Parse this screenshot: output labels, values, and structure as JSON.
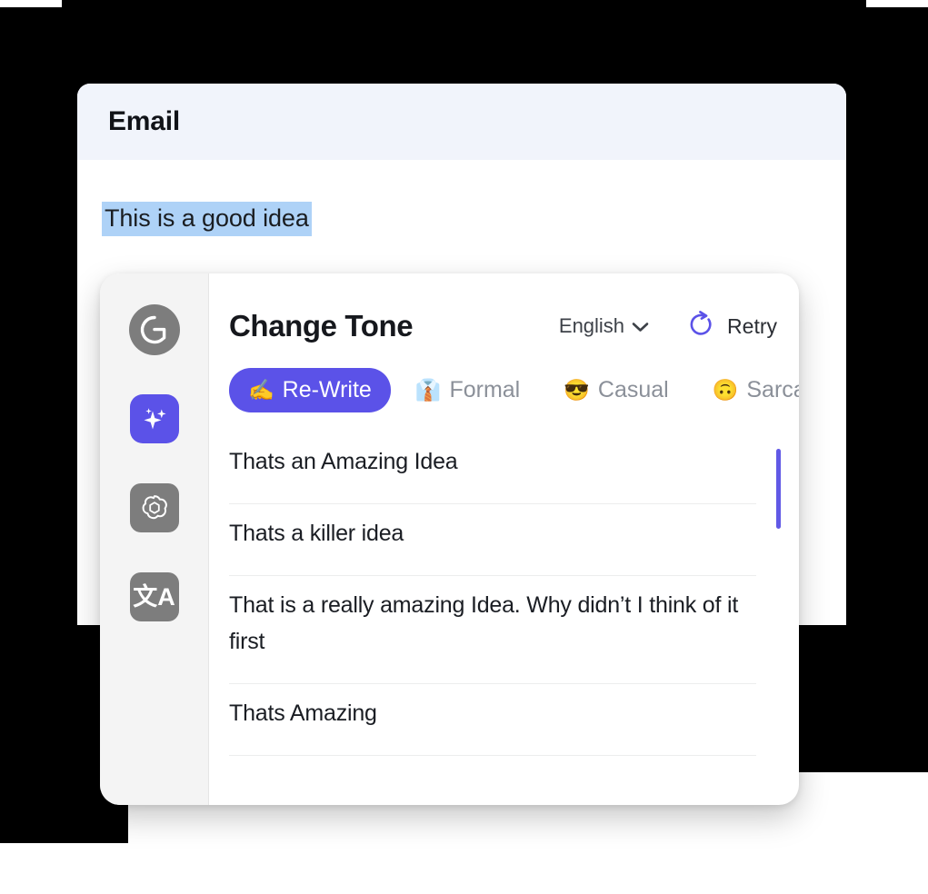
{
  "email_window": {
    "title": "Email",
    "selected_text": "This is a good idea",
    "highlight_color": "#aed2f7"
  },
  "tone_card": {
    "sidebar": {
      "items": [
        {
          "name": "grammarly",
          "icon": "grammarly-logo-icon",
          "active": false
        },
        {
          "name": "ai-assistant",
          "icon": "ai-sparkles-icon",
          "active": true
        },
        {
          "name": "chatgpt",
          "icon": "openai-logo-icon",
          "active": false
        },
        {
          "name": "translate",
          "icon": "translate-icon",
          "glyph": "文A",
          "active": false
        }
      ]
    },
    "heading": "Change Tone",
    "language": {
      "value": "English",
      "chevron": "chevron-down-icon"
    },
    "retry": {
      "label": "Retry",
      "icon": "refresh-circular-arrow-icon",
      "color": "#5b52e8"
    },
    "tones": [
      {
        "label": "Re-Write",
        "emoji": "✍️",
        "active": true
      },
      {
        "label": "Formal",
        "emoji": "👔",
        "active": false
      },
      {
        "label": "Casual",
        "emoji": "😎",
        "active": false
      },
      {
        "label": "Sarcastic",
        "emoji": "🙃",
        "active": false
      }
    ],
    "suggestions": [
      "Thats an Amazing Idea",
      "Thats a killer idea",
      "That is a really amazing Idea. Why didn’t I think of it first",
      "Thats Amazing"
    ],
    "accent_color": "#5b52e8",
    "scrollbar_color": "#6159e6"
  }
}
